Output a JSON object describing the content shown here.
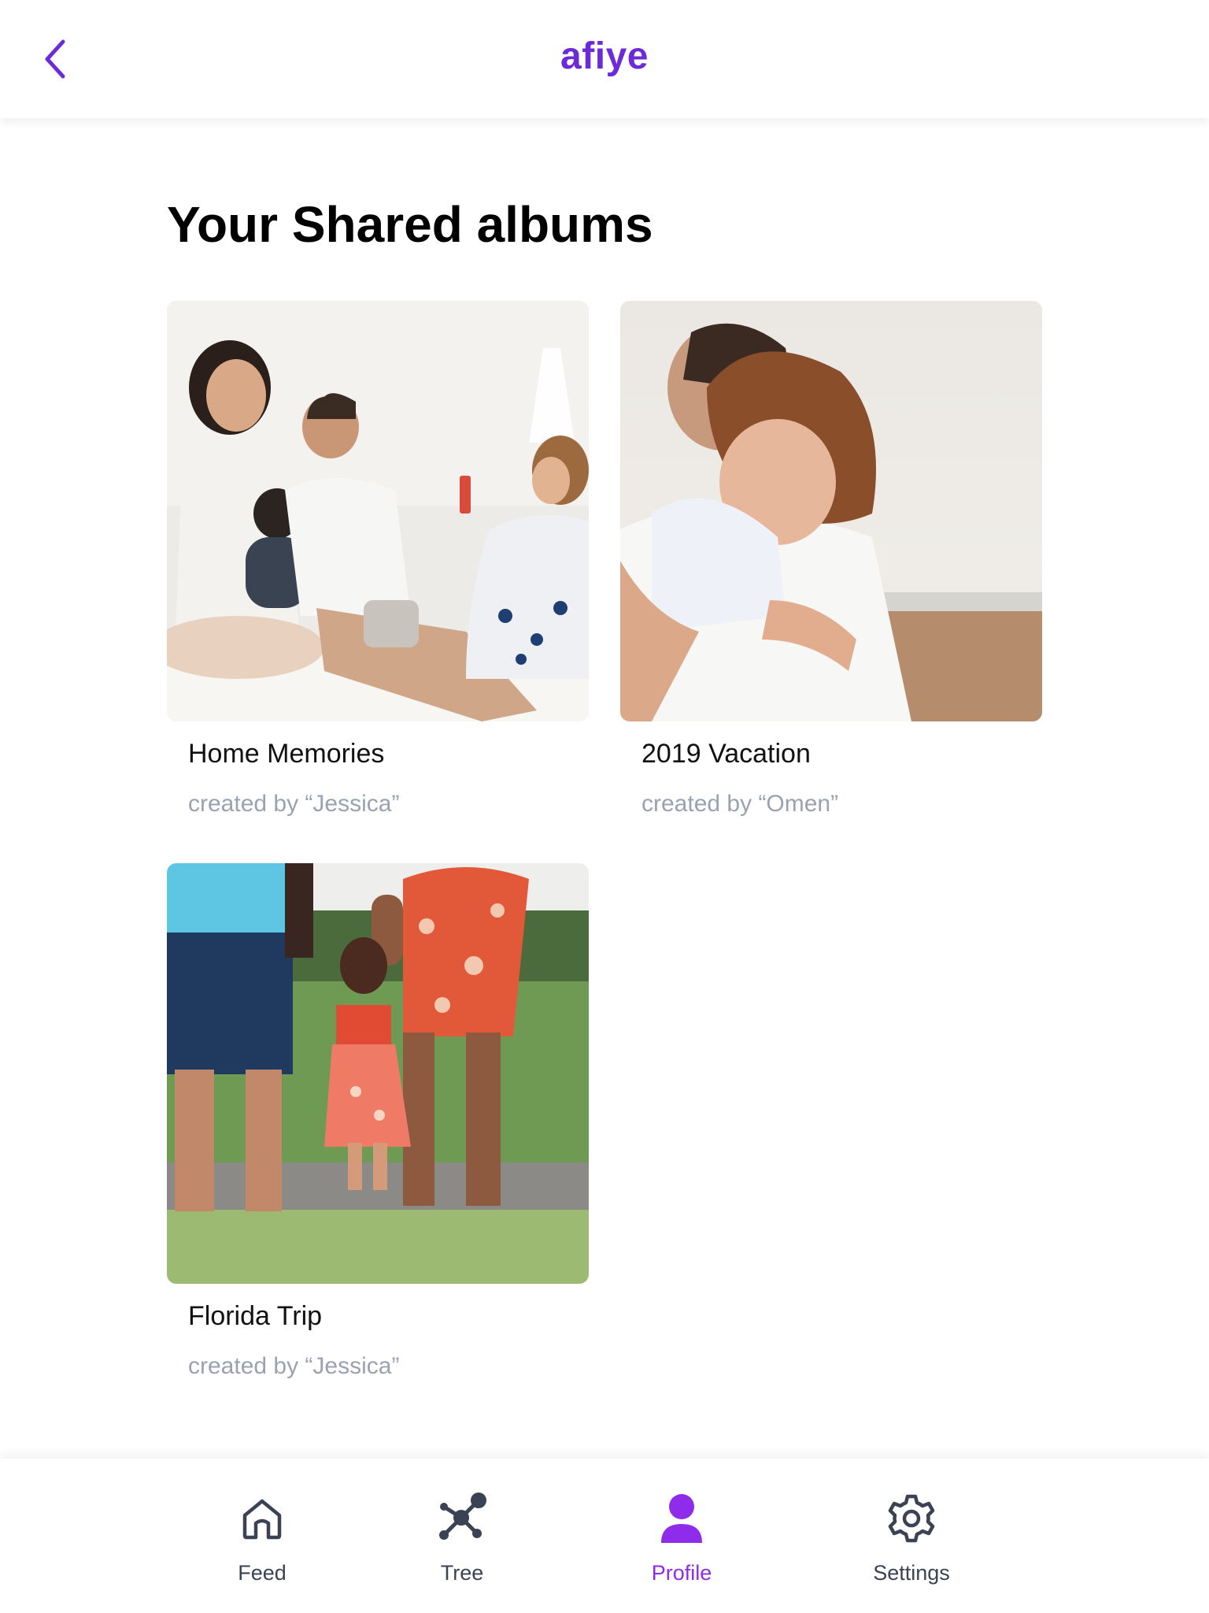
{
  "header": {
    "brand": "afiye",
    "back_icon": "chevron-left-icon",
    "accent_color": "#6c2bd9"
  },
  "main": {
    "title": "Your Shared albums",
    "albums": [
      {
        "name": "Home Memories",
        "creator": "created by “Jessica”",
        "photo": "family-on-bed-photo"
      },
      {
        "name": "2019 Vacation",
        "creator": "created by “Omen”",
        "photo": "child-hug-beach-photo"
      },
      {
        "name": "Florida Trip",
        "creator": "created by “Jessica”",
        "photo": "family-walking-park-photo"
      }
    ]
  },
  "tabbar": {
    "active_color": "#8f2bea",
    "inactive_color": "#3b4254",
    "tabs": [
      {
        "label": "Feed",
        "icon": "home-icon",
        "active": false
      },
      {
        "label": "Tree",
        "icon": "tree-network-icon",
        "active": false
      },
      {
        "label": "Profile",
        "icon": "profile-icon",
        "active": true
      },
      {
        "label": "Settings",
        "icon": "gear-icon",
        "active": false
      }
    ]
  }
}
